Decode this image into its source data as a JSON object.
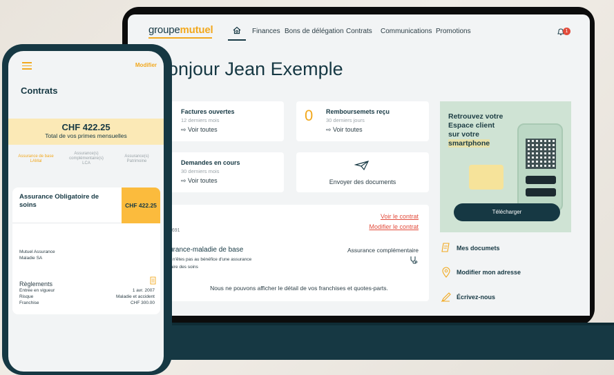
{
  "laptop": {
    "logo": {
      "part1": "groupe",
      "part2": "mutuel"
    },
    "nav": [
      "Finances",
      "Bons de délégation",
      "Contrats",
      "Communications",
      "Promotions"
    ],
    "notification_count": "1",
    "greeting": "onjour Jean Exemple",
    "cards": {
      "factures": {
        "title": "Factures ouvertes",
        "sub": "12 derniers mois",
        "link": "Voir toutes"
      },
      "remboursements": {
        "count": "0",
        "title": "Remboursemets reçu",
        "sub": "30 derniers jours",
        "link": "Voir toutes"
      },
      "demandes": {
        "title": "Demandes en cours",
        "sub": "30 derniers mois",
        "link": "Voir toutes"
      },
      "envoyer": {
        "label": "Envoyer des documents"
      }
    },
    "contract": {
      "voir": "Voir le contrat",
      "modifier": "Modifier le contrat",
      "number": "5691",
      "base_title": "urance-maladie de base",
      "base_note_1": "s n'êtes pas au bénéfice d'une assurance",
      "base_note_2": "taire des soins",
      "complementaire": "Assurance complémentaire",
      "message": "Nous ne pouvons afficher le détail de vos franchises et quotes-parts."
    },
    "promo": {
      "line1": "Retrouvez votre",
      "line2": "Espace client",
      "line3": "sur votre",
      "line4": "smartphone",
      "button": "Télécharger"
    },
    "side_links": [
      "Mes documets",
      "Modifier mon adresse",
      "Écrivez-nous"
    ]
  },
  "phone": {
    "modifier": "Modifier",
    "title": "Contrats",
    "total_amount": "CHF 422.25",
    "total_label": "Total de vos primes mensuelles",
    "tabs": [
      {
        "line1": "Assurance de base",
        "line2": "LAMal"
      },
      {
        "line1": "Assurance(s)",
        "line2": "complémentaire(s)",
        "line3": "LCA"
      },
      {
        "line1": "Assurance(s)",
        "line2": "Patrimoine"
      }
    ],
    "card": {
      "title": "Assurance Obligatoire de soins",
      "amount": "CHF 422.25",
      "insurer_1": "Mutuel Assurance",
      "insurer_2": "Maladie SA",
      "reglements": "Règlements",
      "rows": [
        {
          "label": "Entrée en vigueur",
          "value": "1 avr. 2007"
        },
        {
          "label": "Risque",
          "value": "Maladie et accident"
        },
        {
          "label": "Franchise",
          "value": "CHF 300.00"
        }
      ]
    }
  },
  "colors": {
    "accent": "#f2a81d",
    "navy": "#163843",
    "link_red": "#e24b3b"
  }
}
